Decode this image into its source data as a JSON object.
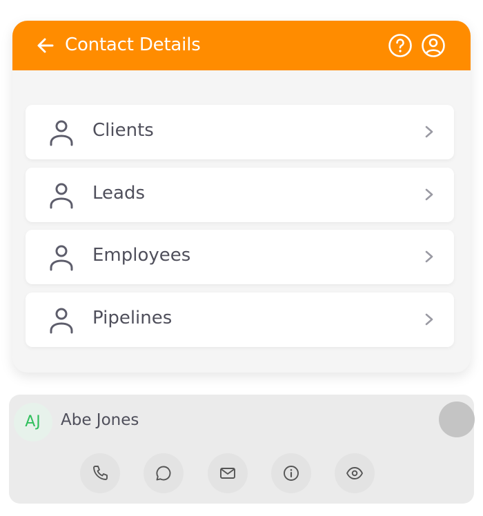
{
  "header": {
    "title": "Contact Details",
    "background": "#ff8c00",
    "icons": [
      "arrow-left-icon",
      "help-circle-icon",
      "user-circle-icon"
    ]
  },
  "menu": {
    "items": [
      {
        "label": "Clients",
        "icon": "person-icon"
      },
      {
        "label": "Leads",
        "icon": "person-icon"
      },
      {
        "label": "Employees",
        "icon": "person-icon"
      },
      {
        "label": "Pipelines",
        "icon": "person-icon"
      }
    ]
  },
  "contact": {
    "initials": "AJ",
    "name": "Abe Jones",
    "initials_color": "#2fbf5c",
    "actions": [
      "phone-icon",
      "chat-icon",
      "mail-icon",
      "info-icon",
      "eye-icon"
    ]
  }
}
